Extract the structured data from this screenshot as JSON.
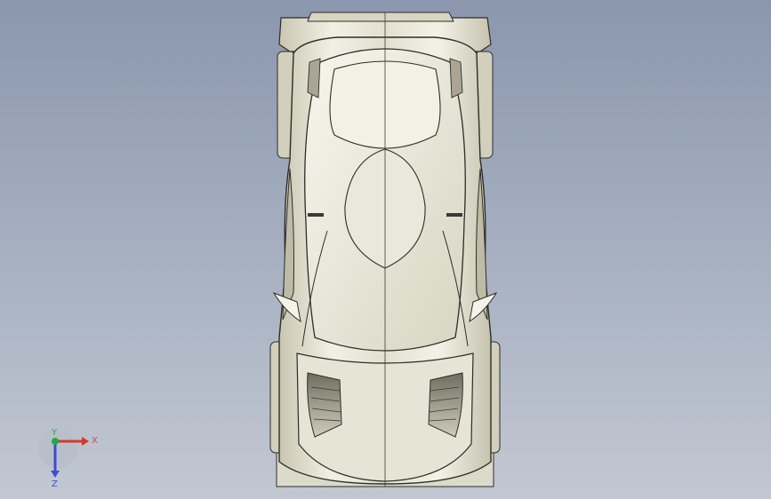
{
  "viewport": {
    "background_top": "#8a97ad",
    "background_bottom": "#c2c8d2",
    "model_fill": "#e3e2d3",
    "model_shade": "#cfcdb9",
    "edge_color": "#2d2d2a"
  },
  "triad": {
    "x_label": "X",
    "y_label": "Y",
    "z_label": "Z",
    "x_color": "#d23b2a",
    "y_color": "#22a845",
    "z_color": "#3a4fd0"
  }
}
